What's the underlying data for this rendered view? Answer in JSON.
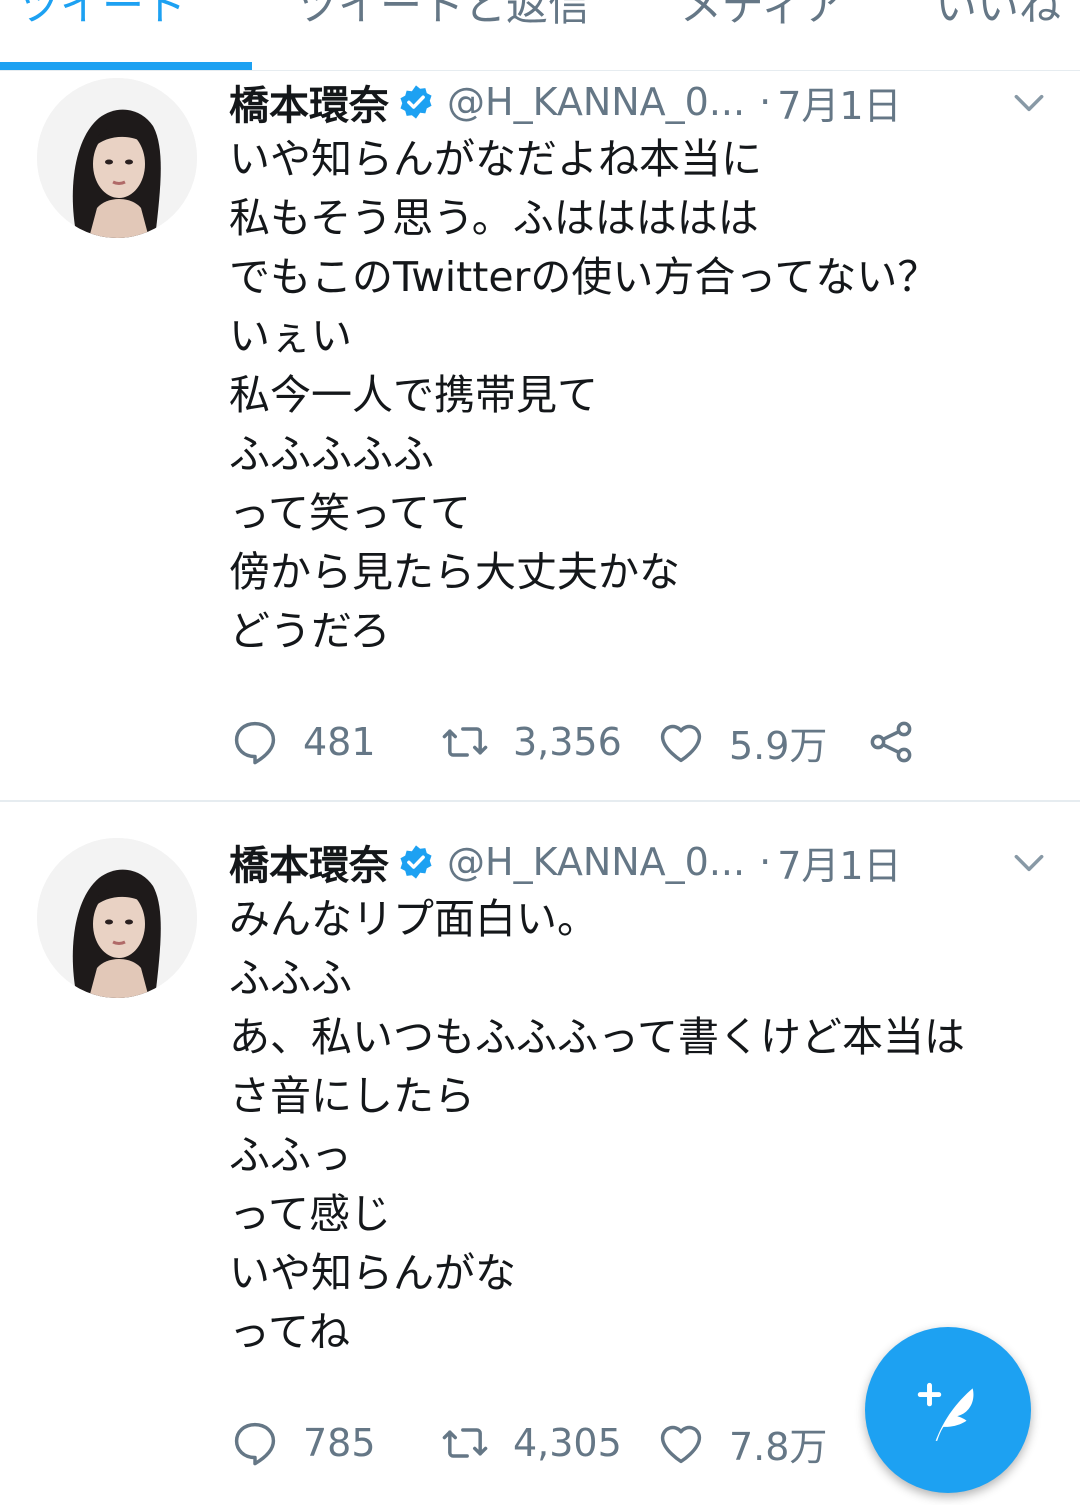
{
  "tabs": [
    {
      "label": "ツイート",
      "active": true
    },
    {
      "label": "ツイートと返信",
      "active": false
    },
    {
      "label": "メディア",
      "active": false
    },
    {
      "label": "いいね",
      "active": false
    }
  ],
  "tweets": [
    {
      "name": "橋本環奈",
      "handle": "@H_KANNA_0...",
      "separator": "·",
      "date": "7月1日",
      "lines": [
        "いや知らんがなだよね本当に",
        "私もそう思う。ふははははは",
        "でもこのTwitterの使い方合ってない？",
        "いぇい",
        "私今一人で携帯見て",
        "ふふふふふ",
        "って笑ってて",
        "傍から見たら大丈夫かな",
        "どうだろ"
      ],
      "replies": "481",
      "retweets": "3,356",
      "likes": "5.9万"
    },
    {
      "name": "橋本環奈",
      "handle": "@H_KANNA_0...",
      "separator": "·",
      "date": "7月1日",
      "lines": [
        "みんなリプ面白い。",
        "ふふふ",
        "あ、私いつもふふふって書くけど本当は",
        "さ音にしたら",
        "ふふっ",
        "って感じ",
        "いや知らんがな",
        "ってね"
      ],
      "replies": "785",
      "retweets": "4,305",
      "likes": "7.8万"
    }
  ],
  "icons": {
    "verified": "verified-badge-icon",
    "caret": "chevron-down-icon",
    "reply": "reply-icon",
    "retweet": "retweet-icon",
    "like": "heart-icon",
    "share": "share-icon",
    "compose": "compose-tweet-icon"
  },
  "colors": {
    "accent": "#1da1f2",
    "text": "#14171a",
    "secondary": "#657786",
    "divider": "#e6ecf0"
  }
}
